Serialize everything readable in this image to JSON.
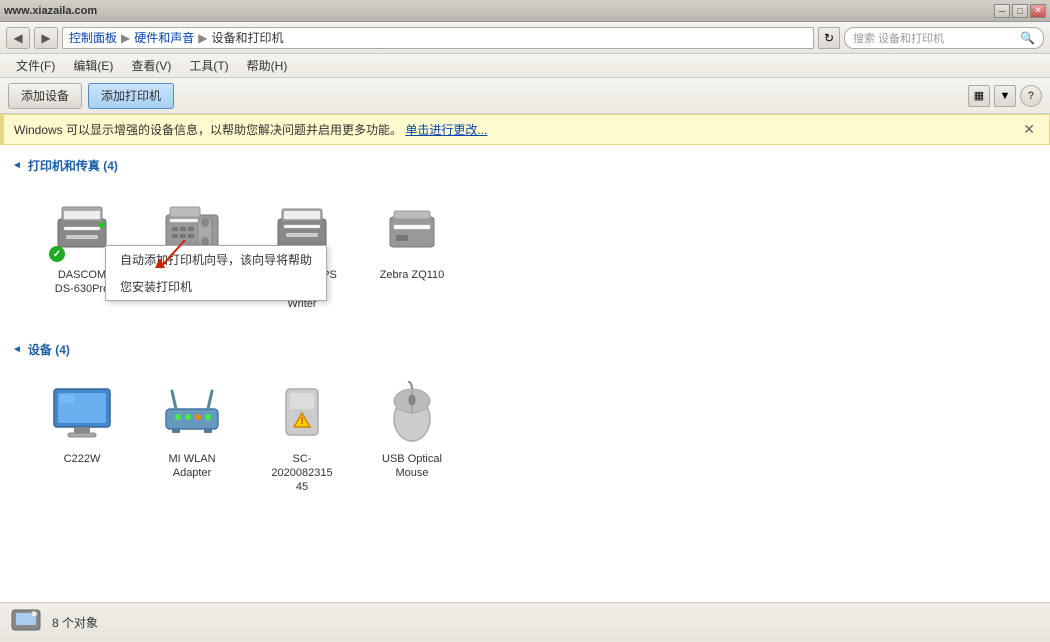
{
  "titlebar": {
    "url": "www.xiazaila.com",
    "min_label": "─",
    "max_label": "□",
    "close_label": "✕"
  },
  "navbar": {
    "back_icon": "◀",
    "forward_icon": "▶",
    "breadcrumb": [
      {
        "label": "控制面板"
      },
      {
        "label": "硬件和声音"
      },
      {
        "label": "设备和打印机"
      }
    ],
    "refresh_icon": "↻",
    "search_placeholder": "搜索 设备和打印机",
    "search_icon": "🔍"
  },
  "menubar": {
    "items": [
      {
        "label": "文件(F)"
      },
      {
        "label": "编辑(E)"
      },
      {
        "label": "查看(V)"
      },
      {
        "label": "工具(T)"
      },
      {
        "label": "帮助(H)"
      }
    ]
  },
  "toolbar": {
    "add_device_label": "添加设备",
    "add_printer_label": "添加打印机",
    "view_icon": "▦",
    "help_icon": "?"
  },
  "notification": {
    "text": "Windows 可以显示增强的设备信息，以帮助您解决问题并启用更多功能。",
    "link_text": "单击进行更改...",
    "close_icon": "✕"
  },
  "tooltip_menu": {
    "items": [
      {
        "label": "自动添加打印机向导，该向导将帮助您安装打印机"
      },
      {
        "label": "您安装打印机"
      }
    ]
  },
  "printers_section": {
    "title": "打印机和传真 (4)",
    "arrow": "◄",
    "items": [
      {
        "id": "dascom",
        "label": "DASCOM\nDS-630Pro",
        "label_line1": "DASCOM",
        "label_line2": "DS-630Pro",
        "has_ok": true
      },
      {
        "id": "fax",
        "label": "Fax",
        "label_line1": "Fax",
        "label_line2": ""
      },
      {
        "id": "xps",
        "label": "Microsoft XPS Document Writer",
        "label_line1": "Microsoft XPS",
        "label_line2": "Document",
        "label_line3": "Writer"
      },
      {
        "id": "zebra",
        "label": "Zebra ZQ110",
        "label_line1": "Zebra ZQ110",
        "label_line2": ""
      }
    ]
  },
  "devices_section": {
    "title": "设备 (4)",
    "arrow": "◄",
    "items": [
      {
        "id": "monitor",
        "label_line1": "C222W",
        "label_line2": ""
      },
      {
        "id": "wlan",
        "label_line1": "MI WLAN",
        "label_line2": "Adapter"
      },
      {
        "id": "sc",
        "label_line1": "SC-2020082315",
        "label_line2": "45",
        "has_warning": true
      },
      {
        "id": "mouse",
        "label_line1": "USB Optical",
        "label_line2": "Mouse"
      }
    ]
  },
  "statusbar": {
    "icon": "📷",
    "text": "8 个对象"
  }
}
